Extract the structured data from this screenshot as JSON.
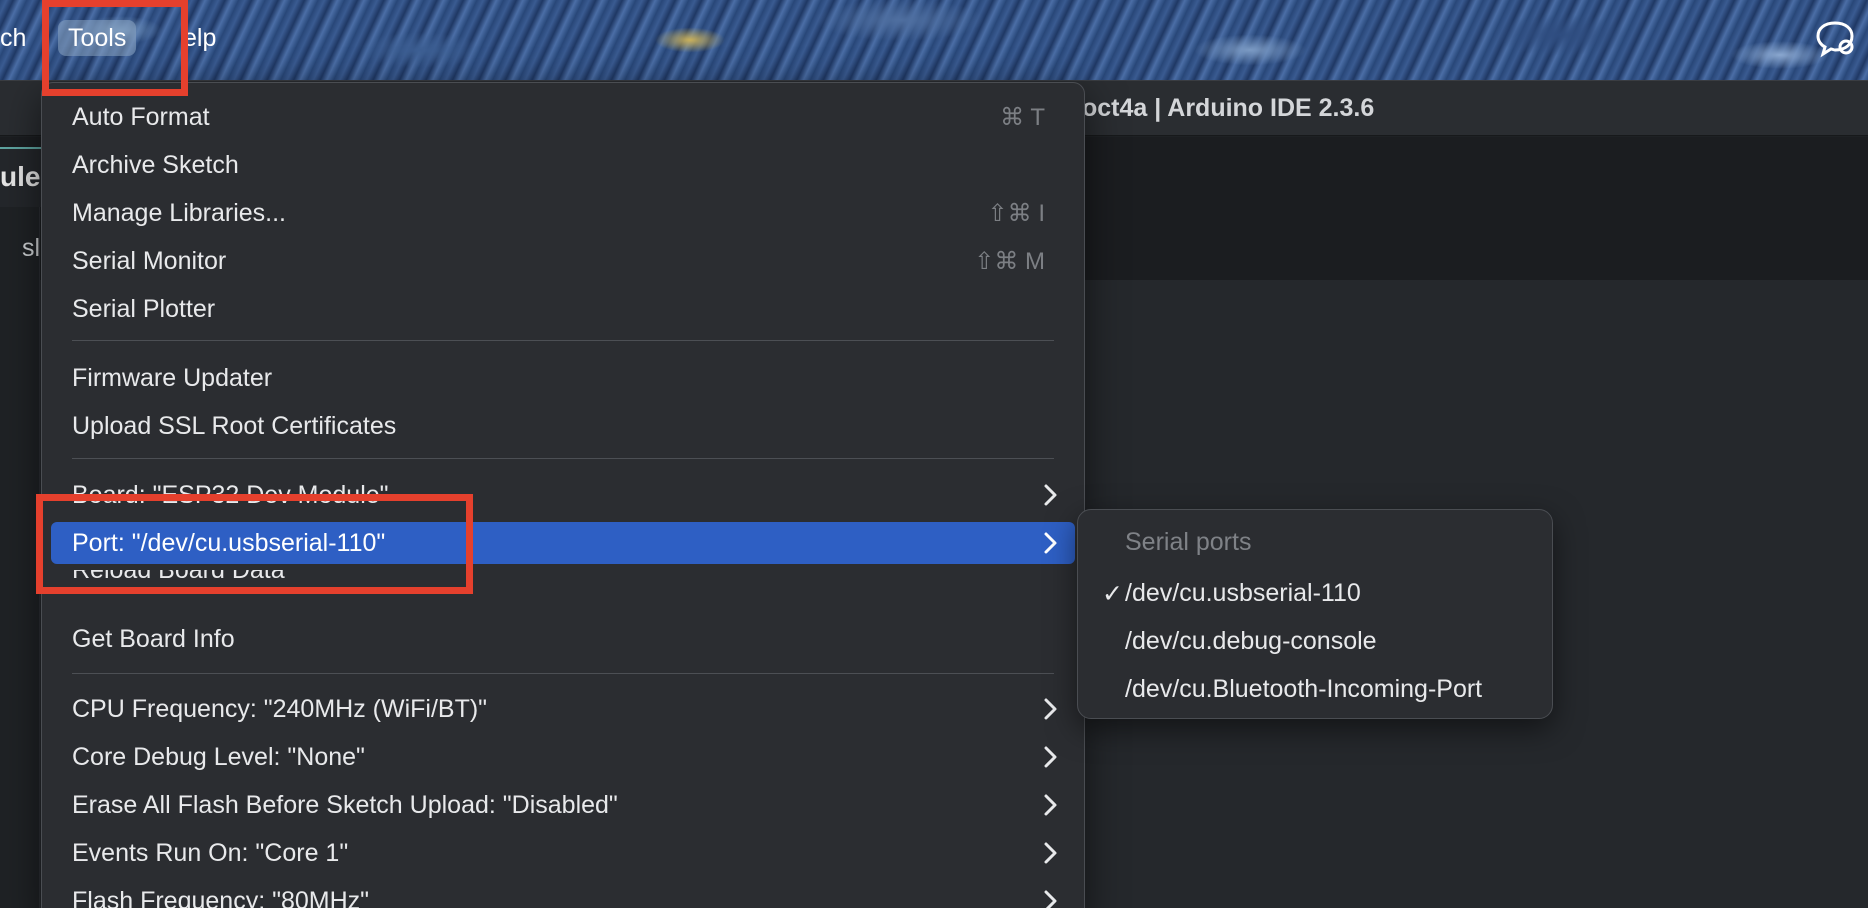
{
  "menubar": {
    "items": [
      {
        "label": "ch"
      },
      {
        "label": "Tools"
      },
      {
        "label": "elp"
      }
    ],
    "right_icon": "chat-bubble-icon"
  },
  "window": {
    "title": "oct4a | Arduino IDE 2.3.6",
    "tab_label": "ule",
    "side_text": "sl"
  },
  "tools_menu": {
    "items": [
      {
        "label": "Auto Format",
        "shortcut": "⌘ T"
      },
      {
        "label": "Archive Sketch"
      },
      {
        "label": "Manage Libraries...",
        "shortcut": "⇧⌘ I"
      },
      {
        "label": "Serial Monitor",
        "shortcut": "⇧⌘ M"
      },
      {
        "label": "Serial Plotter"
      },
      {
        "label": "Firmware Updater"
      },
      {
        "label": "Upload SSL Root Certificates"
      },
      {
        "label": "Board: \"ESP32 Dev Module\""
      },
      {
        "label": "Port: \"/dev/cu.usbserial-110\""
      },
      {
        "label": "Reload Board Data"
      },
      {
        "label": "Get Board Info"
      },
      {
        "label": "CPU Frequency: \"240MHz (WiFi/BT)\""
      },
      {
        "label": "Core Debug Level: \"None\""
      },
      {
        "label": "Erase All Flash Before Sketch Upload: \"Disabled\""
      },
      {
        "label": "Events Run On: \"Core 1\""
      },
      {
        "label": "Flash Frequency: \"80MHz\""
      }
    ]
  },
  "port_submenu": {
    "header": "Serial ports",
    "check_mark": "✓",
    "selected_port": "/dev/cu.usbserial-110",
    "ports": [
      {
        "label": "/dev/cu.usbserial-110"
      },
      {
        "label": "/dev/cu.debug-console"
      },
      {
        "label": "/dev/cu.Bluetooth-Incoming-Port"
      }
    ]
  },
  "colors": {
    "highlight_box": "#e5402d",
    "menu_active": "#2e5fc4",
    "menu_background": "#2b2d31"
  }
}
